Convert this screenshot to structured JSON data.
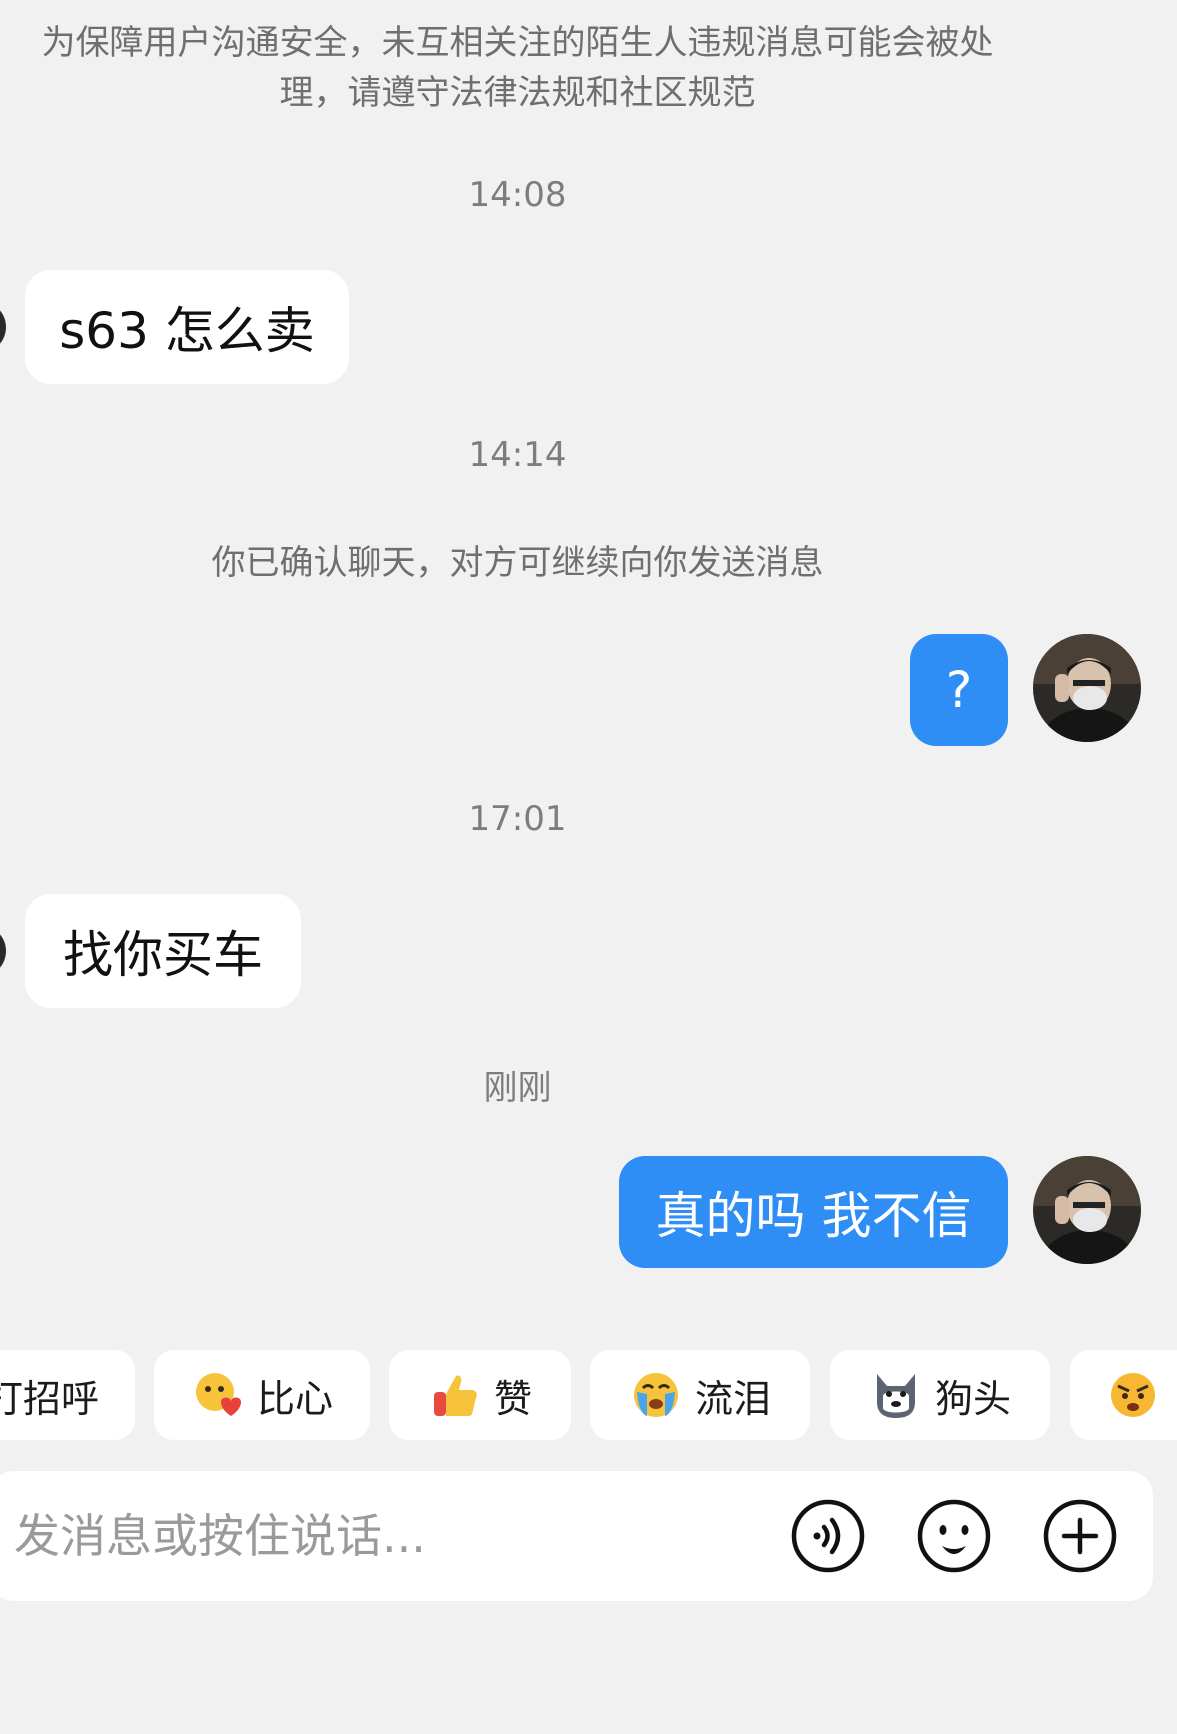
{
  "notice": {
    "line1": "为保障用户沟通安全，未互相关注的陌生人违规消息可能会被处",
    "line2": "理，请遵守法律法规和社区规范"
  },
  "messages": [
    {
      "time": "14:08"
    },
    {
      "side": "in",
      "text": "s63 怎么卖"
    },
    {
      "time": "14:14"
    },
    {
      "system": "你已确认聊天，对方可继续向你发送消息"
    },
    {
      "side": "out",
      "text": "?"
    },
    {
      "time": "17:01"
    },
    {
      "side": "in",
      "text": "找你买车"
    },
    {
      "time": "刚刚"
    },
    {
      "side": "out",
      "text": "真的吗 我不信"
    }
  ],
  "quick_replies": [
    {
      "label": "打招呼",
      "icon": "wave-emoji-icon"
    },
    {
      "label": "比心",
      "icon": "heart-hands-emoji-icon"
    },
    {
      "label": "赞",
      "icon": "thumbs-up-emoji-icon"
    },
    {
      "label": "流泪",
      "icon": "crying-emoji-icon"
    },
    {
      "label": "狗头",
      "icon": "dog-head-emoji-icon"
    },
    {
      "label": "",
      "icon": "angry-emoji-icon"
    }
  ],
  "input": {
    "placeholder": "发消息或按住说话..."
  },
  "colors": {
    "background": "#f1f1f1",
    "outgoing_bubble": "#2f8ef5",
    "incoming_bubble": "#ffffff"
  }
}
